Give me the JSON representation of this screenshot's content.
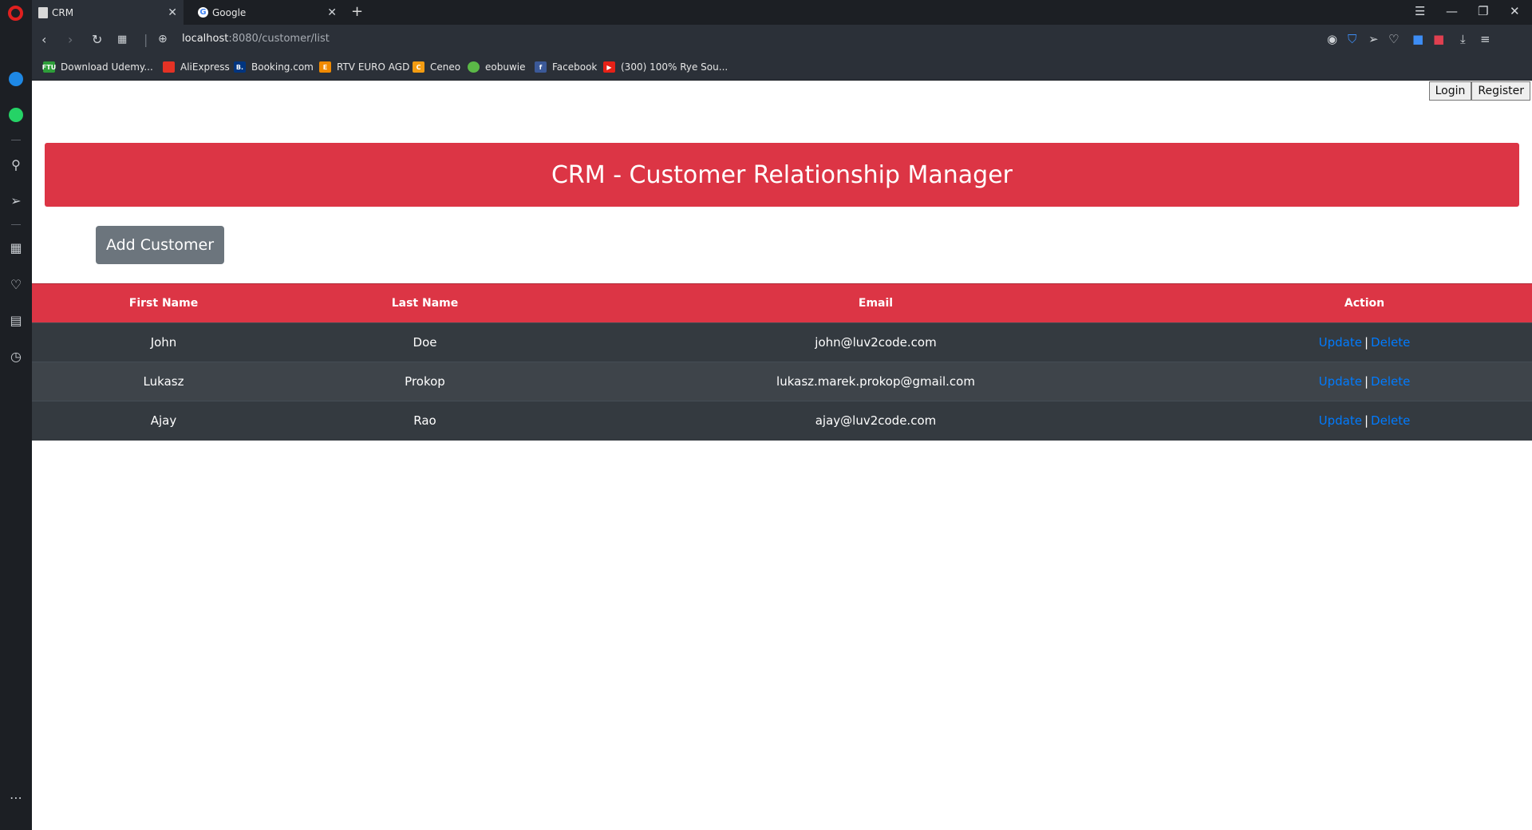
{
  "browser": {
    "tabs": [
      {
        "title": "CRM",
        "active": true
      },
      {
        "title": "Google",
        "active": false
      }
    ],
    "url_host": "localhost",
    "url_rest": ":8080/customer/list",
    "bookmarks": [
      {
        "label": "Download Udemy...",
        "icon_text": "FTU",
        "color": "#2e9e3a"
      },
      {
        "label": "AliExpress",
        "icon_text": "",
        "color": "#e43225"
      },
      {
        "label": "Booking.com",
        "icon_text": "B.",
        "color": "#003580"
      },
      {
        "label": "RTV EURO AGD",
        "icon_text": "E",
        "color": "#f08a00"
      },
      {
        "label": "Ceneo",
        "icon_text": "C",
        "color": "#f39c12"
      },
      {
        "label": "eobuwie",
        "icon_text": "",
        "color": "#5bb847"
      },
      {
        "label": "Facebook",
        "icon_text": "f",
        "color": "#3b5998"
      },
      {
        "label": "(300) 100% Rye Sou...",
        "icon_text": "▶",
        "color": "#e62117"
      }
    ]
  },
  "page": {
    "login_label": "Login",
    "register_label": "Register",
    "title": "CRM - Customer Relationship Manager",
    "add_customer_label": "Add Customer",
    "columns": [
      "First Name",
      "Last Name",
      "Email",
      "Action"
    ],
    "customers": [
      {
        "first_name": "John",
        "last_name": "Doe",
        "email": "john@luv2code.com"
      },
      {
        "first_name": "Lukasz",
        "last_name": "Prokop",
        "email": "lukasz.marek.prokop@gmail.com"
      },
      {
        "first_name": "Ajay",
        "last_name": "Rao",
        "email": "ajay@luv2code.com"
      }
    ],
    "update_label": "Update",
    "delete_label": "Delete",
    "action_separator": "|"
  },
  "colors": {
    "accent": "#dc3545",
    "button_secondary": "#6c757d",
    "link": "#007bff",
    "row_dark": "#343a40"
  }
}
